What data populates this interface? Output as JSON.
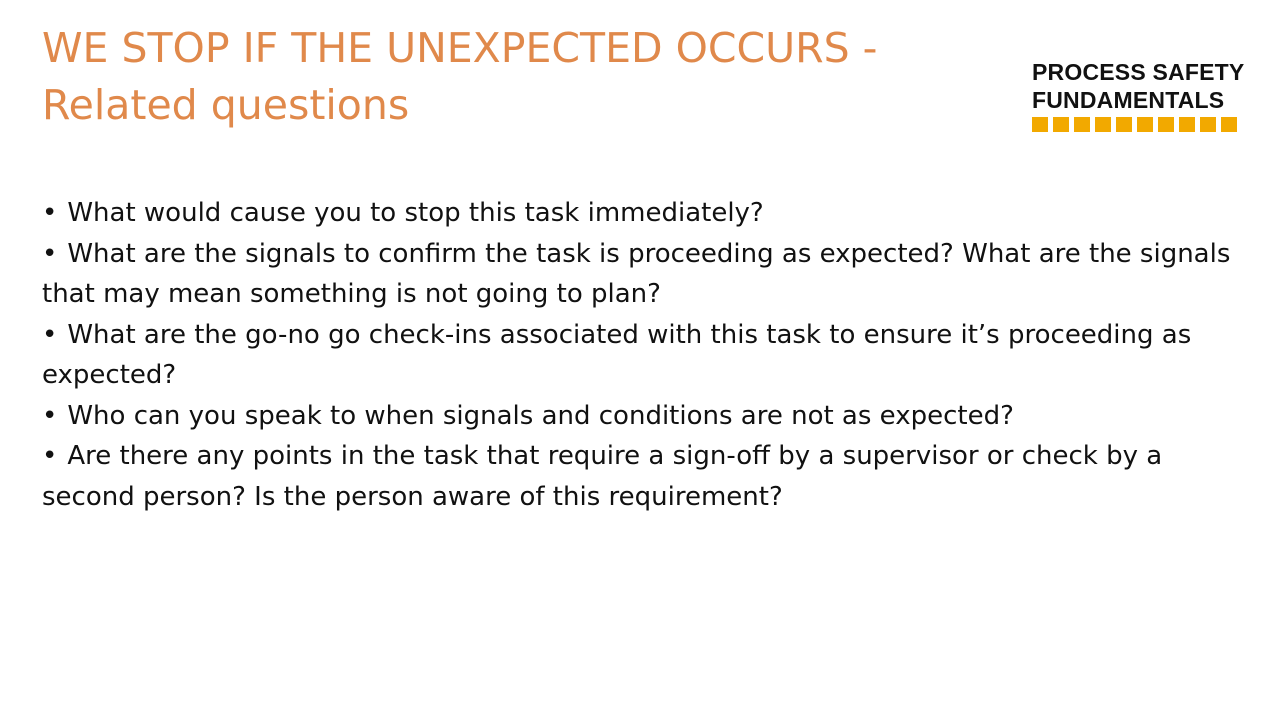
{
  "slide": {
    "title_line1": "WE STOP IF THE UNEXPECTED OCCURS -",
    "title_line2": "Related questions",
    "logo": {
      "line1": "PROCESS SAFETY",
      "line2": "FUNDAMENTALS",
      "bar_color": "#F2A900",
      "bar_segments": 10
    },
    "accent_color": "#E0894B",
    "bullet_glyph": "•",
    "bullets": [
      "What would cause you to stop this task immediately?",
      "What are the signals to confirm the task is proceeding as expected? What are the signals that may mean something is not going to plan?",
      "What are the go-no go check-ins associated with this task to ensure it’s proceeding as expected?",
      "Who can you speak to when signals and conditions are not as expected?",
      "Are there any points in the task that require a sign-off by a supervisor or check by a second person? Is the person aware of this requirement?"
    ]
  }
}
